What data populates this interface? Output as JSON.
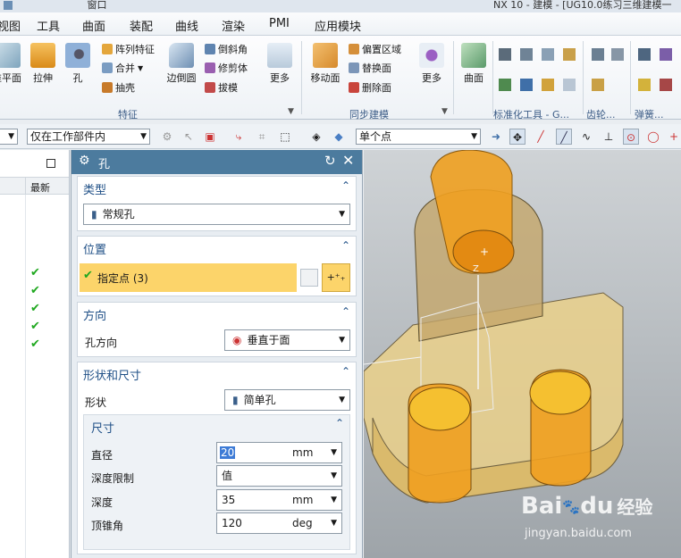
{
  "window": {
    "title": "NX 10 - 建模 - [UG10.0练习三维建模一",
    "quick_access_label": "窗口"
  },
  "menu": {
    "items": [
      "视图",
      "工具",
      "曲面",
      "装配",
      "曲线",
      "渲染",
      "PMI",
      "应用模块"
    ]
  },
  "ribbon": {
    "feature_group": {
      "label": "特征",
      "buttons": {
        "datum_plane": "基准平面",
        "extrude": "拉伸",
        "hole": "孔",
        "edge_blend": "边倒圆",
        "more": "更多"
      },
      "small": [
        "阵列特征",
        "合并",
        "抽壳",
        "倒斜角",
        "修剪体",
        "拔模"
      ]
    },
    "sync_group": {
      "label": "同步建模",
      "buttons": {
        "move_face": "移动面",
        "more": "更多"
      },
      "small": [
        "偏置区域",
        "替换面",
        "删除面"
      ]
    },
    "surface": {
      "label": "曲面"
    },
    "std_tools": {
      "label": "标准化工具 - G..."
    },
    "gear": {
      "label": "齿轮..."
    },
    "spring": {
      "label": "弹簧..."
    }
  },
  "toolbar2": {
    "scope_filter": "仅在工作部件内",
    "snap_mode": "单个点"
  },
  "left_panel": {
    "column_header": "最新",
    "check_count": 5
  },
  "dialog": {
    "title": "孔",
    "type_section": {
      "header": "类型",
      "value": "常规孔"
    },
    "position_section": {
      "header": "位置",
      "specify_point": "指定点 (3)"
    },
    "direction_section": {
      "header": "方向",
      "label": "孔方向",
      "value": "垂直于面"
    },
    "shape_section": {
      "header": "形状和尺寸",
      "shape_label": "形状",
      "shape_value": "简单孔",
      "dimensions": {
        "header": "尺寸",
        "diameter_label": "直径",
        "diameter_value": "20",
        "diameter_unit": "mm",
        "depth_limit_label": "深度限制",
        "depth_limit_value": "值",
        "depth_label": "深度",
        "depth_value": "35",
        "depth_unit": "mm",
        "tip_angle_label": "顶锥角",
        "tip_angle_value": "120",
        "tip_angle_unit": "deg"
      }
    }
  },
  "viewport": {
    "axis_label": "Z",
    "watermark_brand": "Bai",
    "watermark_paw": "du",
    "watermark_cn": "经验",
    "watermark_url": "jingyan.baidu.com"
  },
  "colors": {
    "dialog_title": "#4c7b9e",
    "section_header": "#1e4f86",
    "highlight": "#fcd46a",
    "part_body": "#ead08a",
    "cylinder": "#f0a020"
  }
}
